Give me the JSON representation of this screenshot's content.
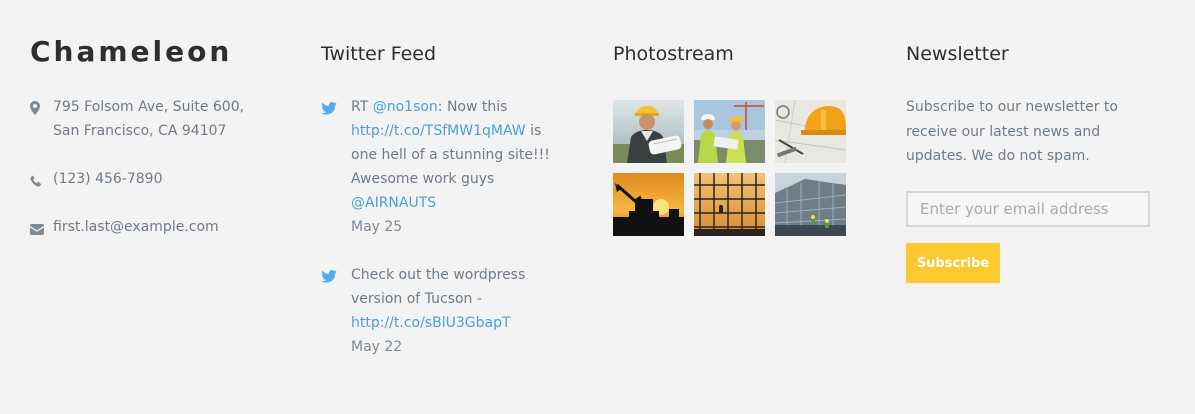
{
  "brand": {
    "name": "Chameleon"
  },
  "contact": {
    "address": "795 Folsom Ave, Suite 600, San Francisco, CA 94107",
    "phone": "(123) 456-7890",
    "email": "first.last@example.com"
  },
  "twitter": {
    "title": "Twitter Feed",
    "tweets": [
      {
        "prefix": "RT ",
        "mention": "@no1son",
        "text1": ": Now this ",
        "link": "http://t.co/TSfMW1qMAW",
        "text2": " is one hell of a stunning site!!! Awesome work guys ",
        "mention2": "@AIRNAUTS",
        "date": "May 25"
      },
      {
        "text1": "Check out the wordpress version of Tucson - ",
        "link": "http://t.co/sBlU3GbapT",
        "date": "May 22"
      }
    ]
  },
  "photostream": {
    "title": "Photostream",
    "photos": [
      "engineer-with-blueprints",
      "workers-on-site",
      "hard-hat-plans",
      "excavator-sunset",
      "scaffolding-sunset",
      "building-construction"
    ]
  },
  "newsletter": {
    "title": "Newsletter",
    "text": "Subscribe to our newsletter to receive our latest news and updates. We do not spam.",
    "placeholder": "Enter your email address",
    "button": "Subscribe"
  },
  "colors": {
    "background": "#f3f3f3",
    "link": "#4a9fd8",
    "button": "#fdc92e"
  }
}
